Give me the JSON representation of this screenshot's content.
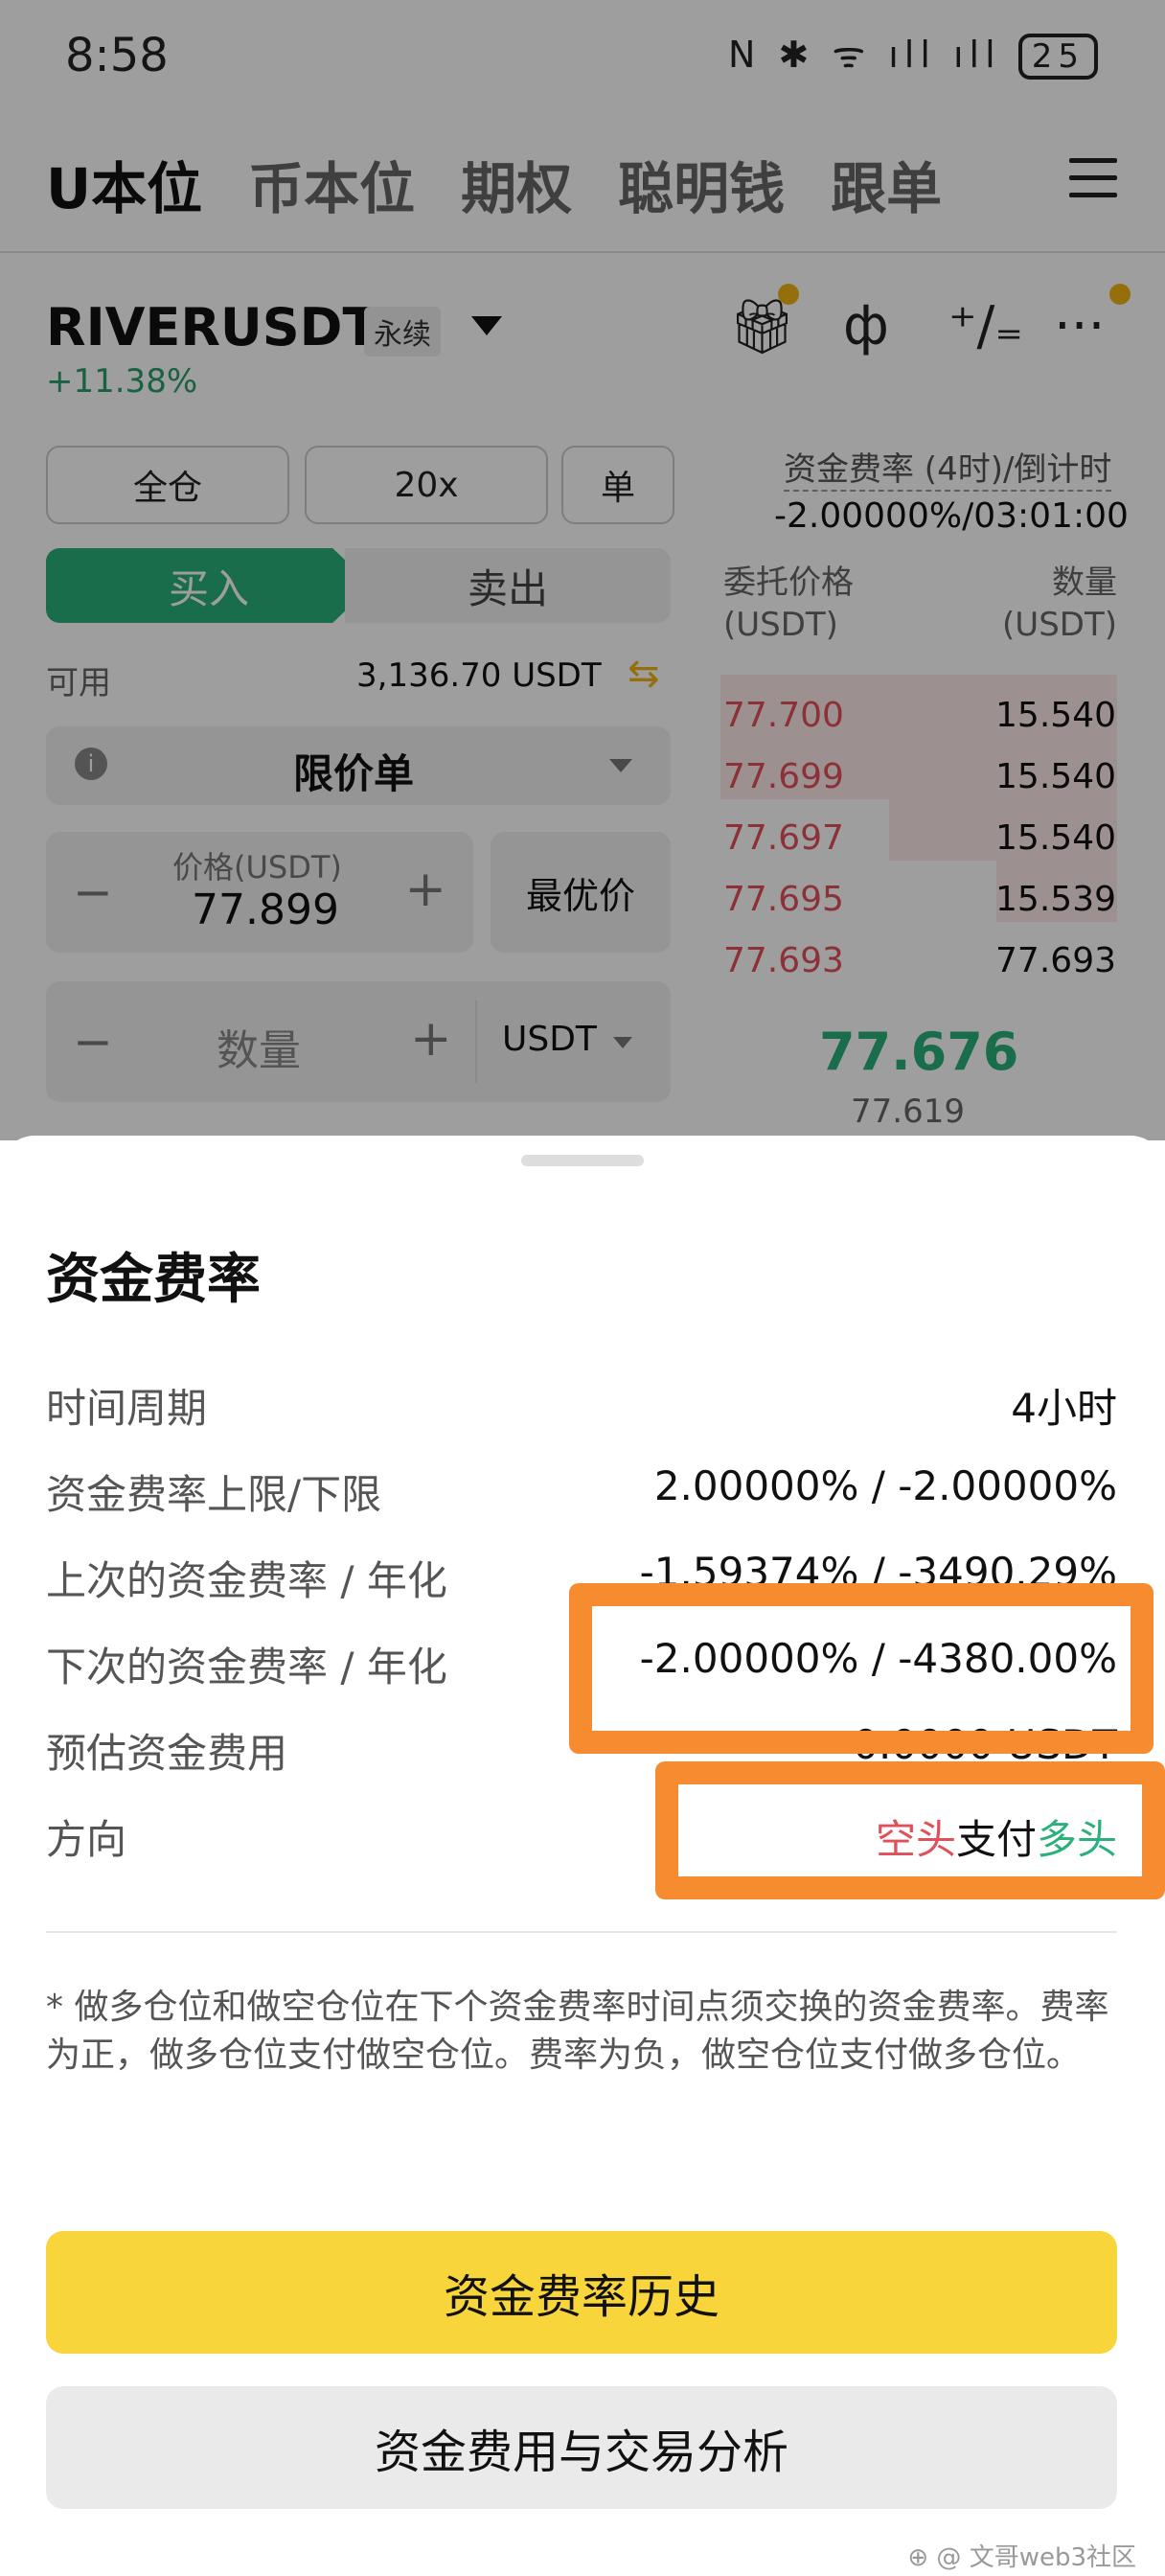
{
  "status": {
    "time": "8:58",
    "icons": "N ✱ ᯤ ıll ıll",
    "battery": "25"
  },
  "nav": {
    "tabs": [
      "U本位",
      "币本位",
      "期权",
      "聪明钱",
      "跟单"
    ]
  },
  "market": {
    "symbol": "RIVERUSDT",
    "perp_badge": "永续",
    "change": "+11.38%"
  },
  "order_form": {
    "margin_mode": "全仓",
    "leverage": "20x",
    "position_mode": "单",
    "buy_label": "买入",
    "sell_label": "卖出",
    "available_label": "可用",
    "available_value": "3,136.70 USDT",
    "order_type": "限价单",
    "price_label": "价格(USDT)",
    "price_value": "77.899",
    "best_price": "最优价",
    "qty_placeholder": "数量",
    "qty_unit": "USDT",
    "minus": "−",
    "plus": "+"
  },
  "funding_header": {
    "label": "资金费率 (4时)/倒计时",
    "value": "-2.00000%/03:01:00"
  },
  "orderbook": {
    "price_header": "委托价格",
    "price_unit": "(USDT)",
    "qty_header": "数量",
    "qty_unit": "(USDT)",
    "asks": [
      {
        "price": "77.700",
        "qty": "15.540"
      },
      {
        "price": "77.699",
        "qty": "15.540"
      },
      {
        "price": "77.697",
        "qty": "15.540"
      },
      {
        "price": "77.695",
        "qty": "15.539"
      },
      {
        "price": "77.693",
        "qty": "77.693"
      }
    ],
    "last_price": "77.676",
    "mark_price": "77.619"
  },
  "sheet": {
    "title": "资金费率",
    "rows": [
      {
        "label": "时间周期",
        "value": "4小时"
      },
      {
        "label": "资金费率上限/下限",
        "value": "2.00000% / -2.00000%"
      },
      {
        "label": "上次的资金费率 / 年化",
        "value": "-1.59374% / -3490.29%"
      },
      {
        "label": "下次的资金费率 / 年化",
        "value": "-2.00000% / -4380.00%"
      },
      {
        "label": "预估资金费用",
        "value": "0.0000 USDT"
      },
      {
        "label": "方向",
        "value": ""
      }
    ],
    "direction": {
      "short": "空头",
      "pay": "支付",
      "long": "多头"
    },
    "note": "* 做多仓位和做空仓位在下个资金费率时间点须交换的资金费率。费率为正，做多仓位支付做空仓位。费率为负，做空仓位支付做多仓位。",
    "btn_history": "资金费率历史",
    "btn_analysis": "资金费用与交易分析"
  },
  "watermark": "⊕ @ 文哥web3社区",
  "colors": {
    "buy": "#2bb07a",
    "sell": "#e0505a",
    "highlight": "#f78b2f",
    "primary_button": "#f9d53c"
  }
}
